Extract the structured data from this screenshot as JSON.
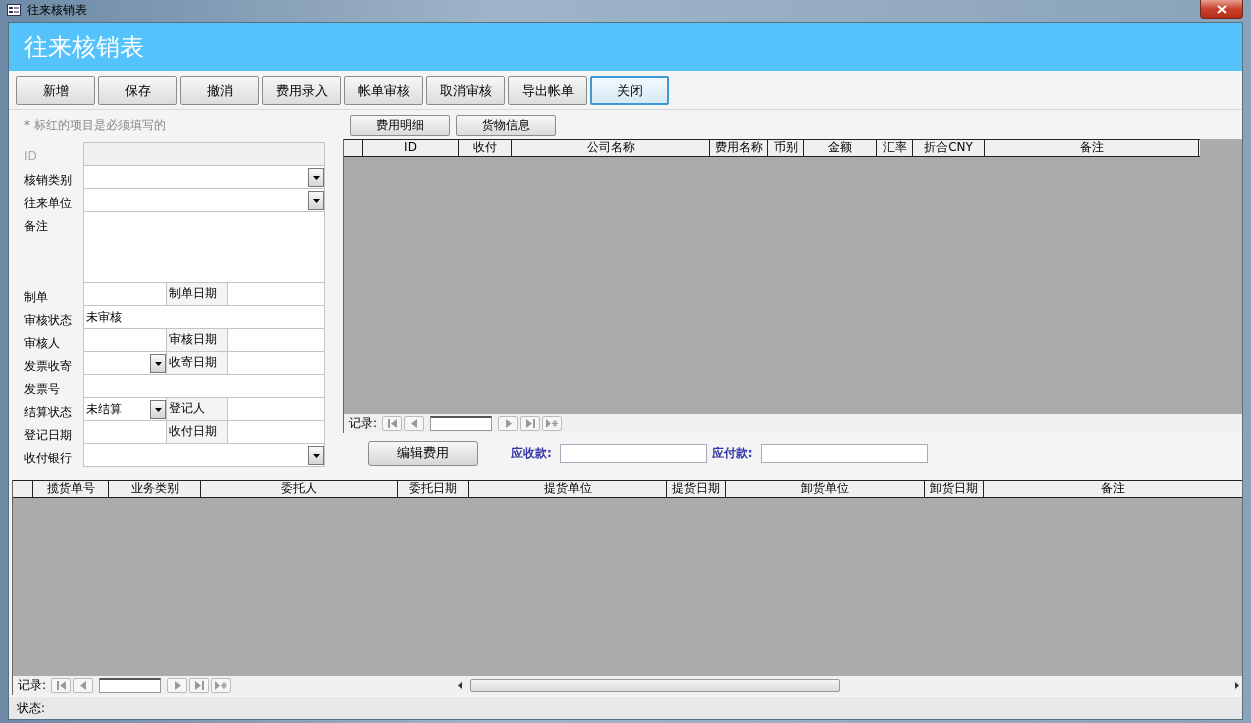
{
  "window": {
    "title": "往来核销表"
  },
  "header": {
    "title": "往来核销表"
  },
  "toolbar": {
    "buttons": [
      {
        "label": "新增",
        "focused": false
      },
      {
        "label": "保存",
        "focused": false
      },
      {
        "label": "撤消",
        "focused": false
      },
      {
        "label": "费用录入",
        "focused": false
      },
      {
        "label": "帐单审核",
        "focused": false
      },
      {
        "label": "取消审核",
        "focused": false
      },
      {
        "label": "导出帐单",
        "focused": false
      },
      {
        "label": "关闭",
        "focused": true
      }
    ]
  },
  "form": {
    "note": "* 标红的项目是必须填写的",
    "rows": [
      {
        "kind": "locked",
        "label": "ID"
      },
      {
        "kind": "combo",
        "label": "核销类别"
      },
      {
        "kind": "combo",
        "label": "往来单位"
      },
      {
        "kind": "memo",
        "label": "备注"
      },
      {
        "kind": "half",
        "label": "制单",
        "second_label": "制单日期"
      },
      {
        "kind": "line",
        "label": "审核状态",
        "value": "未审核"
      },
      {
        "kind": "half",
        "label": "审核人",
        "second_label": "审核日期"
      },
      {
        "kind": "halfcombo",
        "label": "发票收寄",
        "second_label": "收寄日期"
      },
      {
        "kind": "line",
        "label": "发票号"
      },
      {
        "kind": "halfcombo",
        "label": "结算状态",
        "value": "未结算",
        "second_label": "登记人"
      },
      {
        "kind": "half",
        "label": "登记日期",
        "second_label": "收付日期"
      },
      {
        "kind": "combo",
        "label": "收付银行"
      }
    ]
  },
  "detail": {
    "buttons": [
      "费用明细",
      "货物信息"
    ],
    "columns": [
      "ID",
      "收付",
      "公司名称",
      "费用名称",
      "币别",
      "金额",
      "汇率",
      "折合CNY",
      "备注"
    ],
    "nav_label": "记录:"
  },
  "totals": {
    "button": "编辑费用",
    "receivable_label": "应收款:",
    "payable_label": "应付款:"
  },
  "shipments": {
    "columns": [
      "揽货单号",
      "业务类别",
      "委托人",
      "委托日期",
      "提货单位",
      "提货日期",
      "卸货单位",
      "卸货日期",
      "备注"
    ],
    "nav_label": "记录:"
  },
  "status_bar": {
    "label": "状态:"
  }
}
